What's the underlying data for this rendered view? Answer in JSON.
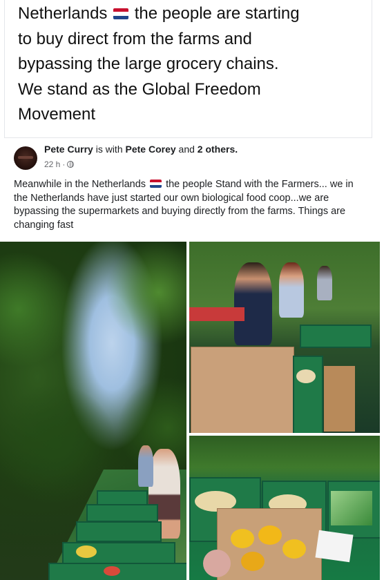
{
  "caption": {
    "line1_before_flag": "Netherlands",
    "line1_after_flag": "the people are starting",
    "line2": "to buy direct from the farms and",
    "line3": "bypassing the large grocery chains.",
    "line4": "We stand as the Global Freedom",
    "line5": "Movement"
  },
  "post": {
    "author_name": "Pete Curry",
    "with_text": "is with",
    "tagged_name": "Pete Corey",
    "and_text": "and",
    "others_text": "2 others.",
    "time": "22 h",
    "separator": "·",
    "privacy_icon": "globe-icon",
    "text_part1": "Meanwhile in the Netherlands",
    "text_part2": "the people Stand with the Farmers... we in the Netherlands have just started our own biological food coop...we are bypassing the supermarkets and buying directly from the farms. Things are changing fast"
  },
  "colors": {
    "flag_red": "#c8102e",
    "flag_white": "#ffffff",
    "flag_blue": "#21468b",
    "crate_green": "#1f7a48"
  }
}
